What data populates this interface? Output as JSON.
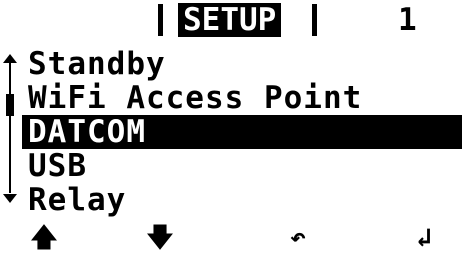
{
  "header": {
    "title": "SETUP",
    "page_number": "1"
  },
  "menu": {
    "items": [
      {
        "label": "Standby"
      },
      {
        "label": "WiFi Access Point"
      },
      {
        "label": "DATCOM"
      },
      {
        "label": "USB"
      },
      {
        "label": "Relay"
      }
    ],
    "selected_index": 2
  },
  "softkeys": {
    "up": "🡅",
    "down": "🡇",
    "back": "↶",
    "enter": "↲"
  },
  "icons": {
    "scroll_up": "scroll-up-arrow-icon",
    "scroll_down": "scroll-down-arrow-icon",
    "key_up": "arrow-up-icon",
    "key_down": "arrow-down-icon",
    "key_back": "back-icon",
    "key_enter": "enter-icon"
  },
  "colors": {
    "foreground": "#000000",
    "background": "#ffffff"
  }
}
